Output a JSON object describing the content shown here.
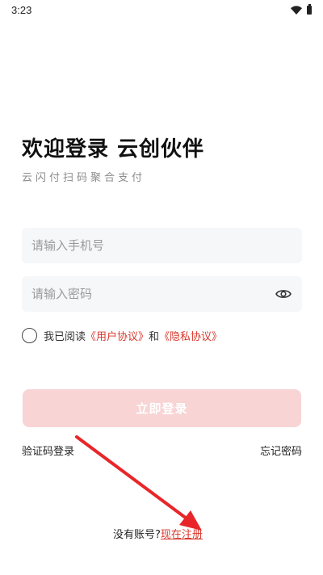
{
  "status_bar": {
    "time": "3:23",
    "wifi_icon": "wifi-icon",
    "battery_icon": "battery-icon"
  },
  "header": {
    "title": "欢迎登录 云创伙伴",
    "subtitle": "云闪付扫码聚合支付"
  },
  "form": {
    "phone_placeholder": "请输入手机号",
    "phone_value": "",
    "password_placeholder": "请输入密码",
    "password_value": "",
    "eye_icon": "eye-icon"
  },
  "agreement": {
    "checked": false,
    "prefix": "我已阅读",
    "user_agreement": "《用户协议》",
    "and": "和",
    "privacy_agreement": "《隐私协议》"
  },
  "actions": {
    "login_label": "立即登录",
    "sms_login_label": "验证码登录",
    "forgot_password_label": "忘记密码"
  },
  "register": {
    "prompt": "没有账号?",
    "link_label": "现在注册"
  },
  "colors": {
    "accent": "#d9372c",
    "button_disabled_bg": "#f8d4d4",
    "field_bg": "#f6f7f9",
    "annotation_arrow": "#e8262a"
  }
}
